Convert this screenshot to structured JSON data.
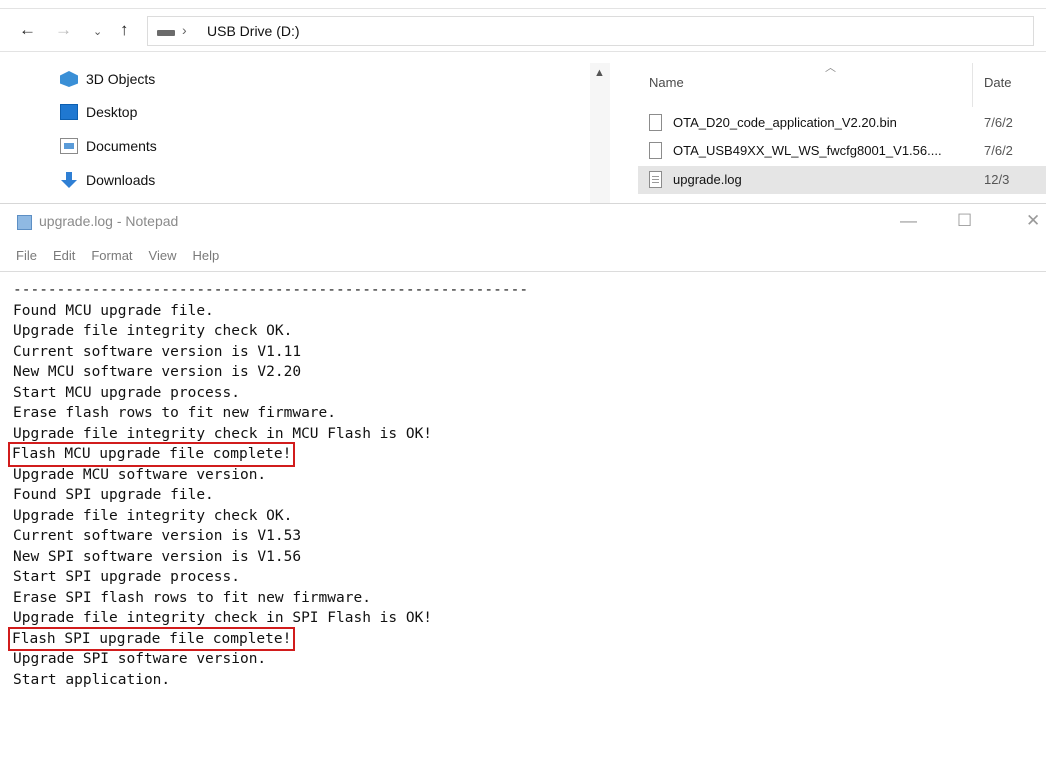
{
  "explorer": {
    "nav": {
      "back_icon": "arrow-left-icon",
      "forward_icon": "arrow-right-icon",
      "recent_icon": "chevron-down-icon",
      "up_icon": "arrow-up-icon"
    },
    "breadcrumb": {
      "separator": "›",
      "location": "USB Drive (D:)"
    },
    "tree": [
      {
        "label": "3D Objects",
        "icon": "3d-objects-icon"
      },
      {
        "label": "Desktop",
        "icon": "desktop-icon"
      },
      {
        "label": "Documents",
        "icon": "documents-icon"
      },
      {
        "label": "Downloads",
        "icon": "downloads-icon"
      }
    ],
    "columns": {
      "name": "Name",
      "date": "Date"
    },
    "files": [
      {
        "name": "OTA_D20_code_application_V2.20.bin",
        "date": "7/6/2"
      },
      {
        "name": "OTA_USB49XX_WL_WS_fwcfg8001_V1.56....",
        "date": "7/6/2"
      },
      {
        "name": "upgrade.log",
        "date": "12/3",
        "selected": true
      }
    ]
  },
  "notepad": {
    "title": "upgrade.log - Notepad",
    "window_buttons": {
      "minimize": "—",
      "maximize": "☐",
      "close": "✕"
    },
    "menu": [
      "File",
      "Edit",
      "Format",
      "View",
      "Help"
    ],
    "lines": [
      "-----------------------------------------------------------",
      "Found MCU upgrade file.",
      "Upgrade file integrity check OK.",
      "Current software version is V1.11",
      "New MCU software version is V2.20",
      "Start MCU upgrade process.",
      "Erase flash rows to fit new firmware.",
      "Upgrade file integrity check in MCU Flash is OK!",
      "Flash MCU upgrade file complete!",
      "Upgrade MCU software version.",
      "Found SPI upgrade file.",
      "Upgrade file integrity check OK.",
      "Current software version is V1.53",
      "New SPI software version is V1.56",
      "Start SPI upgrade process.",
      "Erase SPI flash rows to fit new firmware.",
      "Upgrade file integrity check in SPI Flash is OK!",
      "Flash SPI upgrade file complete!",
      "Upgrade SPI software version.",
      "Start application."
    ],
    "highlight_color": "#d11c1c"
  }
}
